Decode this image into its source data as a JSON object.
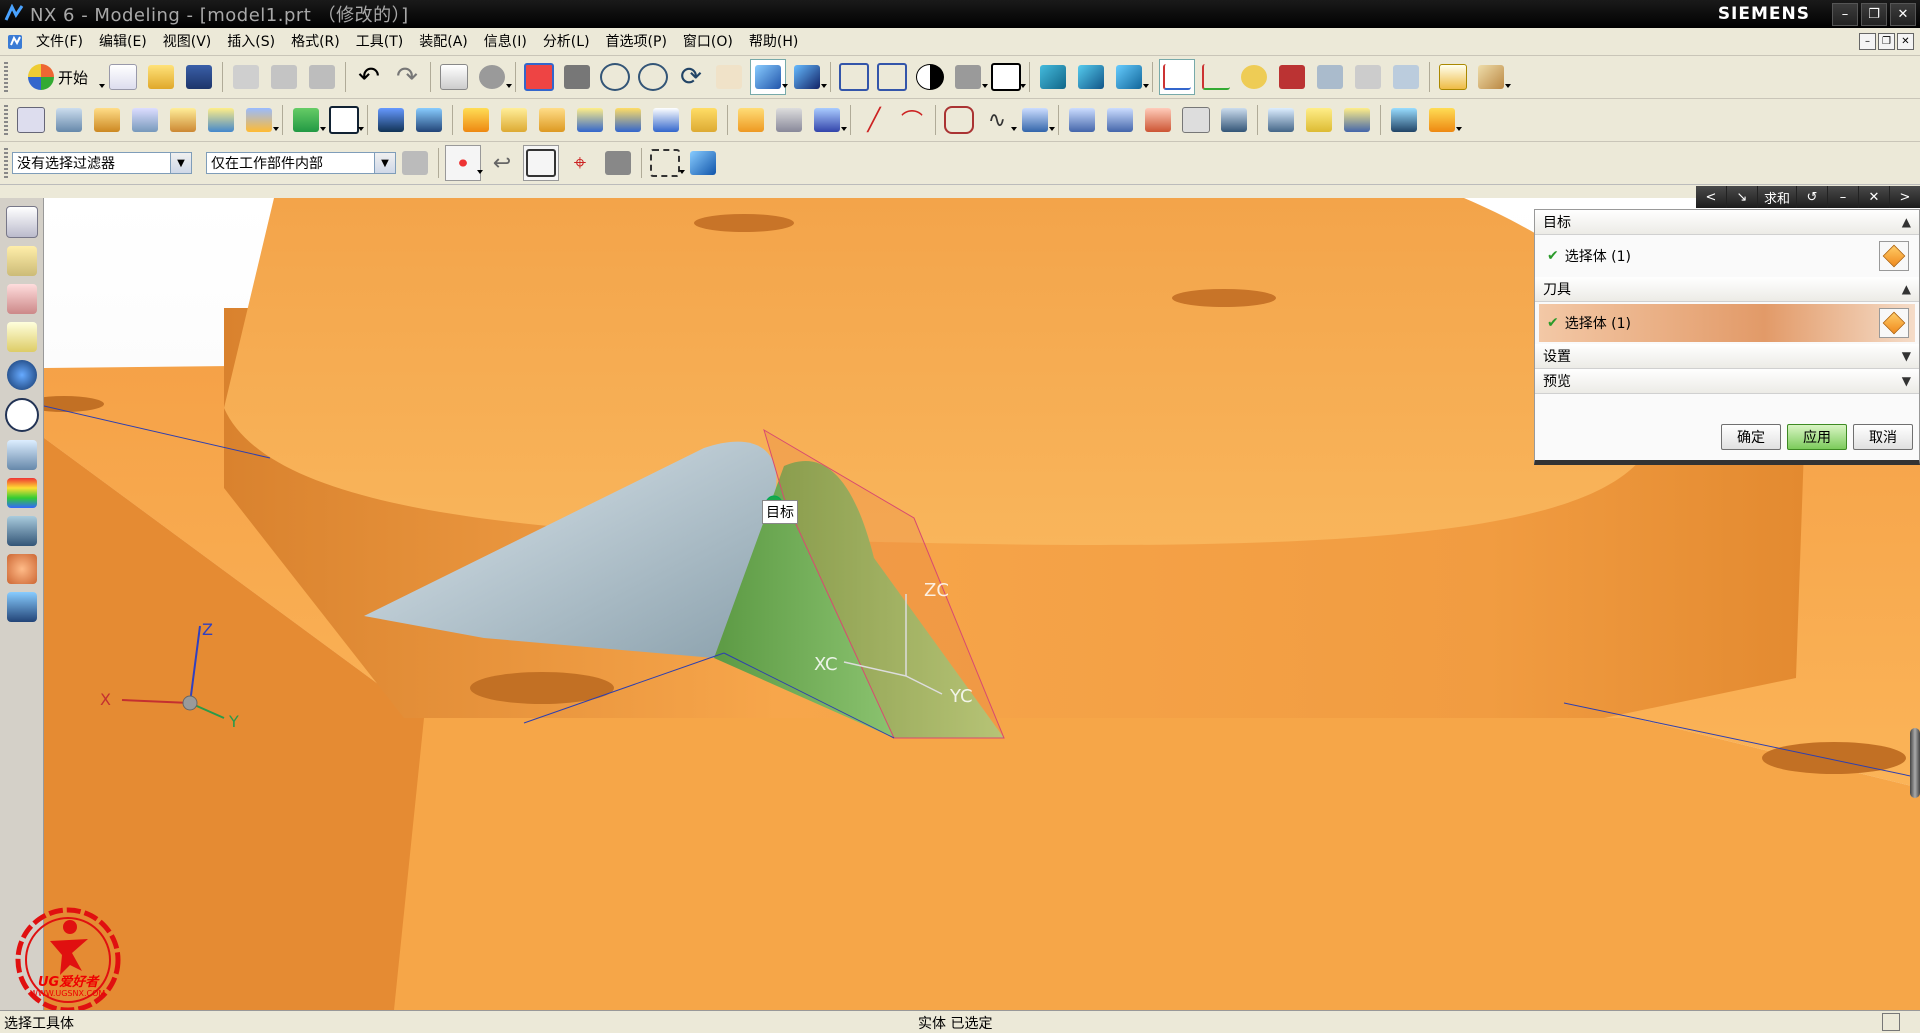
{
  "window": {
    "title": "NX 6 - Modeling - [model1.prt （修改的）]",
    "brand": "SIEMENS",
    "controls": [
      "–",
      "❐",
      "✕"
    ]
  },
  "menubar": {
    "items": [
      {
        "label": "文件(F)"
      },
      {
        "label": "编辑(E)"
      },
      {
        "label": "视图(V)"
      },
      {
        "label": "插入(S)"
      },
      {
        "label": "格式(R)"
      },
      {
        "label": "工具(T)"
      },
      {
        "label": "装配(A)"
      },
      {
        "label": "信息(I)"
      },
      {
        "label": "分析(L)"
      },
      {
        "label": "首选项(P)"
      },
      {
        "label": "窗口(O)"
      },
      {
        "label": "帮助(H)"
      }
    ]
  },
  "toolbar_standard": {
    "start_label": "开始",
    "icons": [
      "new-icon",
      "open-icon",
      "save-icon",
      "cut-icon",
      "copy-icon",
      "paste-icon",
      "undo-icon",
      "redo-icon",
      "command-finder-icon",
      "touch-mode-icon",
      "fit-icon",
      "zoom-region-icon",
      "zoom-icon",
      "zoom-in-out-icon",
      "rotate-icon",
      "pan-icon",
      "shaded-edges-icon",
      "shaded-icon",
      "wireframe-icon",
      "static-wireframe-icon",
      "lightweight-icon",
      "face-analysis-icon",
      "background-icon",
      "orient-icon",
      "trimetric-icon",
      "iso-icon",
      "snap-view-icon",
      "wcs-icon",
      "datum-csys-icon",
      "point-icon",
      "measure-icon",
      "hide-icon",
      "show-icon",
      "select-icon",
      "ruler-icon",
      "gear-icon"
    ]
  },
  "toolbar_feature": {
    "icons": [
      "sketch-icon",
      "extrude-icon",
      "revolve-icon",
      "sweep-icon",
      "tube-icon",
      "hole-icon",
      "boss-icon",
      "block-icon",
      "cylinder-icon",
      "cone-icon",
      "sphere-icon",
      "blend-icon",
      "chamfer-icon",
      "shell-icon",
      "draft-icon",
      "offset-icon",
      "trim-icon",
      "split-icon",
      "unite-icon",
      "subtract-icon",
      "line-icon",
      "arc-icon",
      "curve-icon",
      "spline-icon",
      "project-icon",
      "through-curves-icon",
      "mesh-icon",
      "sew-icon",
      "face-icon",
      "patch-icon",
      "thicken-icon",
      "bounded-plane-icon",
      "shell-face-icon",
      "sheet-icon",
      "extract-icon"
    ]
  },
  "selection_bar": {
    "type_filter": "没有选择过滤器",
    "scope": "仅在工作部件内部"
  },
  "dialog": {
    "title": "求和",
    "tab_controls": [
      "<",
      "↘",
      "求和",
      "↺",
      "–",
      "✕",
      ">"
    ],
    "groups": [
      {
        "label": "目标",
        "expanded": true,
        "selection": "选择体 (1)",
        "active": false
      },
      {
        "label": "刀具",
        "expanded": true,
        "selection": "选择体 (1)",
        "active": true
      },
      {
        "label": "设置",
        "expanded": false
      },
      {
        "label": "预览",
        "expanded": false
      }
    ],
    "buttons": {
      "ok": "确定",
      "apply": "应用",
      "cancel": "取消"
    }
  },
  "viewport": {
    "target_tag": "目标",
    "wcs_labels": {
      "z": "ZC",
      "x": "XC",
      "y": "YC"
    },
    "abs_labels": {
      "z": "Z",
      "x": "X",
      "y": "Y"
    }
  },
  "statusbar": {
    "left": "选择工具体",
    "center": "实体 已选定"
  },
  "watermark": {
    "text": "UG爱好者",
    "url": "WWW.UGSNX.COM"
  },
  "colors": {
    "model_orange": "#f6a349",
    "tool_green": "#8fcc6e",
    "tool_silver": "#c5d3db",
    "titlebar": "#000000",
    "apply_green": "#7ccb5c"
  }
}
